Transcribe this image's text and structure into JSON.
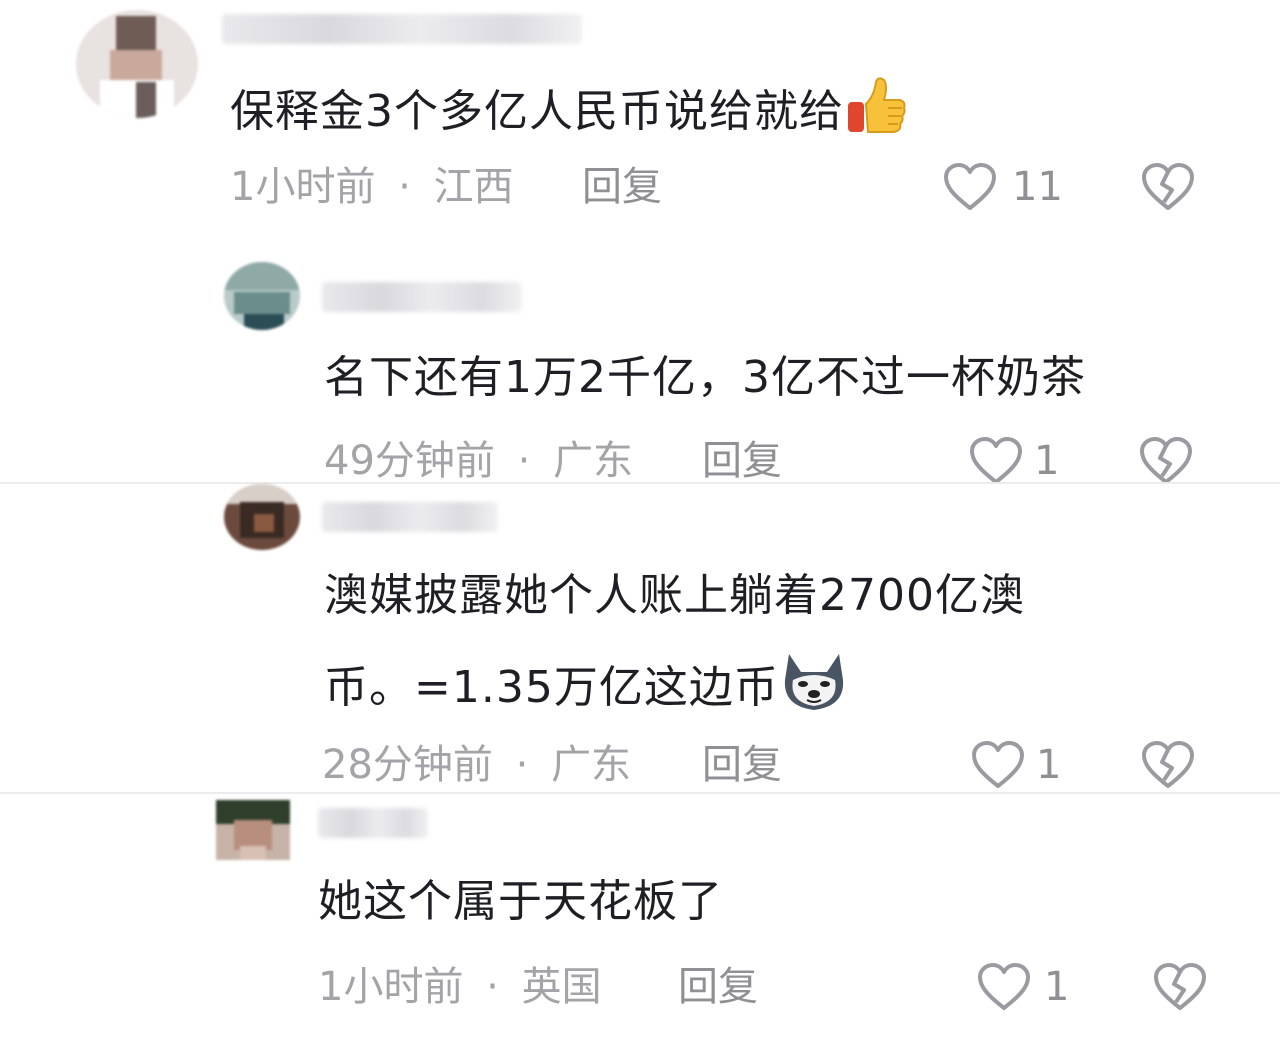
{
  "comments": [
    {
      "text": "保释金3个多亿人民币说给就给",
      "emoji": "thumbs-up-icon",
      "time": "1小时前",
      "separator": "·",
      "location": "江西",
      "reply_label": "回复",
      "likes": "11"
    },
    {
      "text": "名下还有1万2千亿，3亿不过一杯奶茶",
      "time": "49分钟前",
      "separator": "·",
      "location": "广东",
      "reply_label": "回复",
      "likes": "1"
    },
    {
      "text_line1": "澳媒披露她个人账上躺着2700亿澳",
      "text_line2": "币。=1.35万亿这边币",
      "emoji": "husky-dog-icon",
      "time": "28分钟前",
      "separator": "·",
      "location": "广东",
      "reply_label": "回复",
      "likes": "1"
    },
    {
      "text": "她这个属于天花板了",
      "time": "1小时前",
      "separator": "·",
      "location": "英国",
      "reply_label": "回复",
      "likes": "1"
    }
  ]
}
